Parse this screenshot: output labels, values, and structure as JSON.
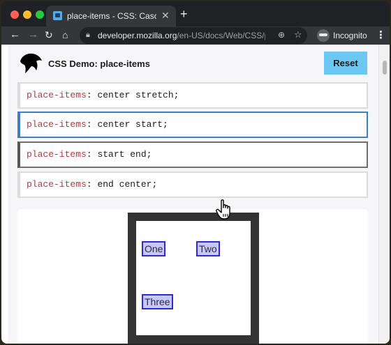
{
  "browser": {
    "tab": {
      "title": "place-items - CSS: Cascading St",
      "close": "✕"
    },
    "new_tab": "+",
    "nav": {
      "back": "←",
      "forward": "→",
      "reload": "↻",
      "home": "⌂"
    },
    "url": {
      "host": "developer.mozilla.org",
      "path": "/en-US/docs/Web/CSS/plac..."
    },
    "profile_label": "Incognito",
    "menu": "⋮"
  },
  "demo": {
    "title": "CSS Demo: place-items",
    "reset_label": "Reset",
    "choices": [
      {
        "property": "place-items",
        "value": "center stretch;"
      },
      {
        "property": "place-items",
        "value": "center start;"
      },
      {
        "property": "place-items",
        "value": "start end;"
      },
      {
        "property": "place-items",
        "value": "end center;"
      }
    ],
    "output_items": [
      "One",
      "Two",
      "Three"
    ]
  },
  "colors": {
    "accent_selected": "#3d7ec7",
    "reset_button": "#6cc8f2",
    "property_name": "#b9373b",
    "item_border": "#2b2bdd",
    "item_fill": "#c8c8f7"
  },
  "icons": [
    "lock-icon",
    "zoom-icon",
    "star-icon",
    "incognito-icon",
    "mdn-logo-icon",
    "hand-cursor-icon"
  ]
}
